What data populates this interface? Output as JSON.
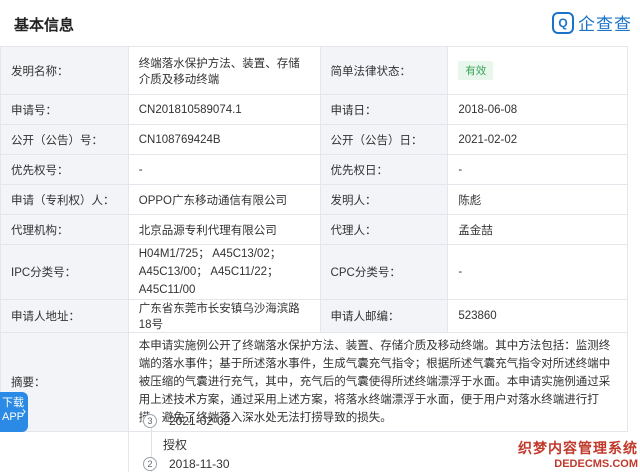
{
  "header": {
    "title": "基本信息",
    "logo_text": "企查查",
    "logo_mark": "Q"
  },
  "rows": [
    {
      "l1": "发明名称：",
      "v1": "终端落水保护方法、装置、存储介质及移动终端",
      "l2": "简单法律状态：",
      "v2": "有效"
    },
    {
      "l1": "申请号：",
      "v1": "CN201810589074.1",
      "l2": "申请日：",
      "v2": "2018-06-08"
    },
    {
      "l1": "公开（公告）号：",
      "v1": "CN108769424B",
      "l2": "公开（公告）日：",
      "v2": "2021-02-02"
    },
    {
      "l1": "优先权号：",
      "v1": "-",
      "l2": "优先权日：",
      "v2": "-"
    },
    {
      "l1": "申请（专利权）人：",
      "v1": "OPPO广东移动通信有限公司",
      "l2": "发明人：",
      "v2": "陈彪"
    },
    {
      "l1": "代理机构：",
      "v1": "北京品源专利代理有限公司",
      "l2": "代理人：",
      "v2": "孟金喆"
    },
    {
      "l1": "IPC分类号：",
      "v1": "H04M1/725； A45C13/02； A45C13/00； A45C11/22； A45C11/00",
      "l2": "CPC分类号：",
      "v2": "-"
    },
    {
      "l1": "申请人地址：",
      "v1": "广东省东莞市长安镇乌沙海滨路18号",
      "l2": "申请人邮编：",
      "v2": "523860"
    }
  ],
  "abstract": {
    "label": "摘要：",
    "text": "本申请实施例公开了终端落水保护方法、装置、存储介质及移动终端。其中方法包括：监测终端的落水事件；基于所述落水事件，生成气囊充气指令；根据所述气囊充气指令对所述终端中被压缩的气囊进行充气，其中，充气后的气囊使得所述终端漂浮于水面。本申请实施例通过采用上述技术方案，通过采用上述方案，将落水终端漂浮于水面，便于用户对落水终端进行打捞，避免了终端落入深水处无法打捞导致的损失。"
  },
  "timeline": [
    {
      "num": "3",
      "date": "2021-02-02",
      "event": "授权"
    },
    {
      "num": "2",
      "date": "2018-11-30",
      "event": ""
    }
  ],
  "sidetab": {
    "line1": "下载",
    "line2": "APP"
  },
  "watermark": {
    "line1": "织梦内容管理系统",
    "line2": "DEDECMS.COM"
  },
  "colors": {
    "link": "#1a73c9",
    "valid_badge": "#3aa35b",
    "label_bg": "#f2f4f7"
  }
}
